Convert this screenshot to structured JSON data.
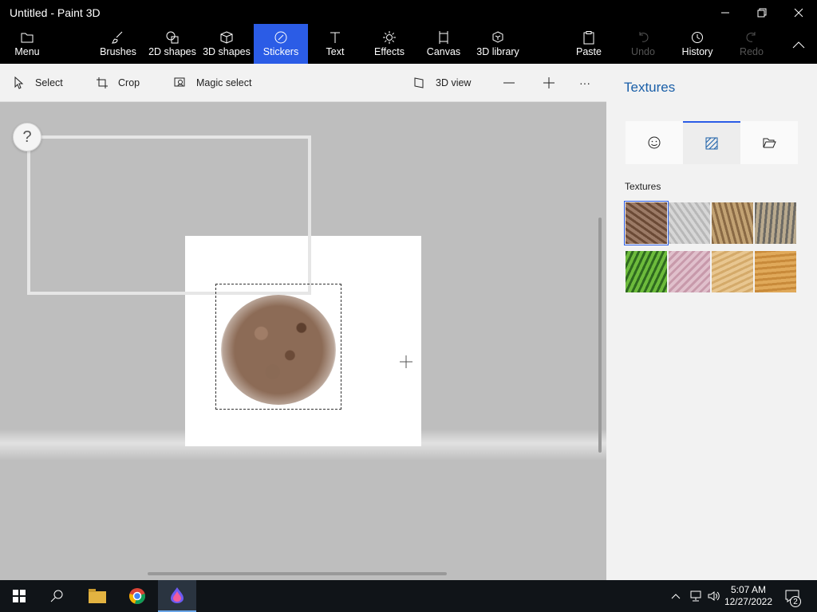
{
  "window": {
    "title": "Untitled - Paint 3D"
  },
  "toolbar": {
    "menu": "Menu",
    "tools": [
      {
        "label": "Brushes"
      },
      {
        "label": "2D shapes"
      },
      {
        "label": "3D shapes"
      },
      {
        "label": "Stickers"
      },
      {
        "label": "Text"
      },
      {
        "label": "Effects"
      },
      {
        "label": "Canvas"
      },
      {
        "label": "3D library"
      }
    ],
    "paste": "Paste",
    "undo": "Undo",
    "history": "History",
    "redo": "Redo"
  },
  "subtoolbar": {
    "select": "Select",
    "crop": "Crop",
    "magic_select": "Magic select",
    "view_3d": "3D view",
    "more": "···"
  },
  "canvas": {
    "help": "?"
  },
  "panel": {
    "title": "Textures",
    "section_label": "Textures",
    "textures": [
      {
        "name": "bark",
        "colors": [
          "#6b4a36",
          "#9b7a66"
        ]
      },
      {
        "name": "granite",
        "colors": [
          "#b8b8b8",
          "#d6d6d6"
        ]
      },
      {
        "name": "wood-hair",
        "colors": [
          "#8a6a45",
          "#c2a273"
        ]
      },
      {
        "name": "pebbles",
        "colors": [
          "#6d6a64",
          "#b9a98d"
        ]
      },
      {
        "name": "leaves",
        "colors": [
          "#2f6a1f",
          "#6dbb3c"
        ]
      },
      {
        "name": "pink-marble",
        "colors": [
          "#c89aab",
          "#e0c0cc"
        ]
      },
      {
        "name": "sand",
        "colors": [
          "#d4aa6a",
          "#e8c690"
        ]
      },
      {
        "name": "wood",
        "colors": [
          "#c88a3a",
          "#e0a95a"
        ]
      }
    ]
  },
  "taskbar": {
    "time": "5:07 AM",
    "date": "12/27/2022",
    "notifications": "2"
  }
}
